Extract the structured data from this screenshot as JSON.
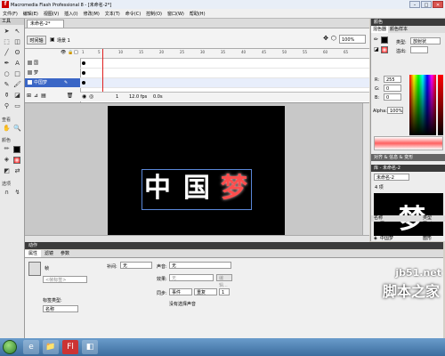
{
  "window": {
    "title": "Macromedia Flash Professional 8 - [未命名-2*]"
  },
  "menu": [
    "文件(F)",
    "编辑(E)",
    "视图(V)",
    "插入(I)",
    "修改(M)",
    "文本(T)",
    "命令(C)",
    "控制(O)",
    "窗口(W)",
    "帮助(H)"
  ],
  "tools": {
    "header": "工具",
    "view_label": "查看",
    "colors_label": "颜色",
    "options_label": "选项"
  },
  "document": {
    "tab": "未命名-2*",
    "back_label": "时间轴",
    "scene": "场景 1",
    "zoom": "100%"
  },
  "timeline": {
    "layers": [
      "国",
      "梦",
      "中国梦"
    ],
    "ticks": [
      "1",
      "5",
      "10",
      "15",
      "20",
      "25",
      "30",
      "35",
      "40",
      "45",
      "50",
      "55",
      "60",
      "65"
    ],
    "frame": "1",
    "fps": "12.0 fps",
    "time": "0.0s"
  },
  "stage": {
    "chars": [
      "中",
      "国",
      "梦"
    ]
  },
  "actions_panel": {
    "title": "动作"
  },
  "properties": {
    "tabs": [
      "属性",
      "滤镜",
      "参数"
    ],
    "instance_placeholder": "<帧标签>",
    "label_type_label": "标签类型:",
    "label_type_value": "名称",
    "frame_label": "帧",
    "tween_label": "补间:",
    "tween_value": "无",
    "sound_label": "声音:",
    "sound_value": "无",
    "effect_label": "效果:",
    "effect_value": "无",
    "edit_button": "编辑...",
    "sync_label": "同步:",
    "sync_event": "事件",
    "sync_repeat": "重复",
    "sync_count": "1",
    "no_sound": "没有选择声音"
  },
  "color_panel": {
    "header": "颜色",
    "tabs": [
      "混色器",
      "颜色样本"
    ],
    "type_label": "类型:",
    "type_value": "放射状",
    "overflow_label": "溢出:",
    "r": "255",
    "g": "0",
    "b": "0",
    "alpha_label": "Alpha:",
    "alpha_value": "100%",
    "hex": "#FF0000"
  },
  "library": {
    "header": "库 - 未命名-2",
    "doc_select": "未命名-2",
    "count": "4 项",
    "columns": [
      "名称",
      "类型"
    ],
    "items": [
      {
        "name": "国",
        "type": "图形"
      },
      {
        "name": "梦",
        "type": "图形"
      },
      {
        "name": "中",
        "type": "图形"
      },
      {
        "name": "中国梦",
        "type": "图形"
      }
    ],
    "secondary_header": "对齐 & 信息 & 变形"
  },
  "watermark": {
    "line1": "jb51.net",
    "line2": "脚本之家"
  },
  "taskbar": {
    "items": [
      "e",
      "📁",
      "Fl",
      "◧"
    ]
  },
  "colors": {
    "accent": "#3a66c6",
    "stage_bg": "#000000",
    "highlight": "#ff4d4d"
  }
}
